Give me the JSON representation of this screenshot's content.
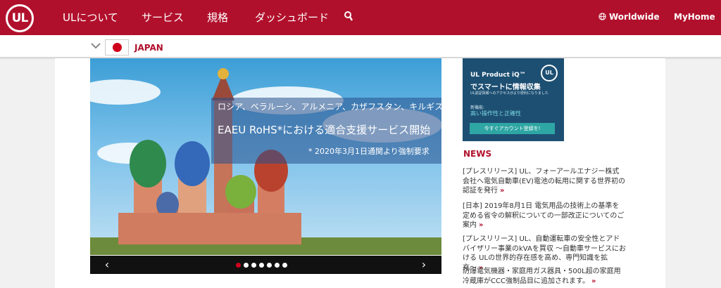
{
  "header": {
    "logo_text": "UL",
    "nav": [
      "ULについて",
      "サービス",
      "規格",
      "ダッシュボード"
    ],
    "worldwide_label": "Worldwide",
    "myhome_label": "MyHome"
  },
  "locale": {
    "country": "JAPAN"
  },
  "hero": {
    "line1": "ロシア、ベラルーシ、アルメニア、カザフスタン、キルギス",
    "line2": "EAEU RoHS*における適合支援サービス開始",
    "line3": "* 2020年3月1日通関より強制要求",
    "prev_label": "‹",
    "next_label": "›",
    "slide_count": 7,
    "active_slide": 1
  },
  "ad": {
    "title1": "UL Product iQ™",
    "title2": "でスマートに情報収集",
    "sub": "UL認証情報へのアクセスがより便利になりました",
    "feature_label": "新機能:",
    "feature": "高い操作性と正確性",
    "button": "今すぐアカウント登録を!",
    "logo_text": "UL"
  },
  "news": {
    "heading": "NEWS",
    "more_label": "»",
    "items": [
      "[プレスリリース] UL、フォーアールエナジー株式会社へ電気自動車(EV)電池の転用に関する世界初の認証を発行",
      "[日本] 2019年8月1日 電気用品の技術上の基準を定める省令の解釈についての一部改正についてのご案内",
      "[プレスリリース] UL、自動運転車の安全性とアドバイザリー事業のkVAを買収 〜自動車サービスにおける ULの世界的存在感を高め、専門知識を拡充〜",
      "防爆電気機器・家庭用ガス器具・500L超の家庭用冷蔵庫がCCC強制品目に追加されます。"
    ]
  }
}
